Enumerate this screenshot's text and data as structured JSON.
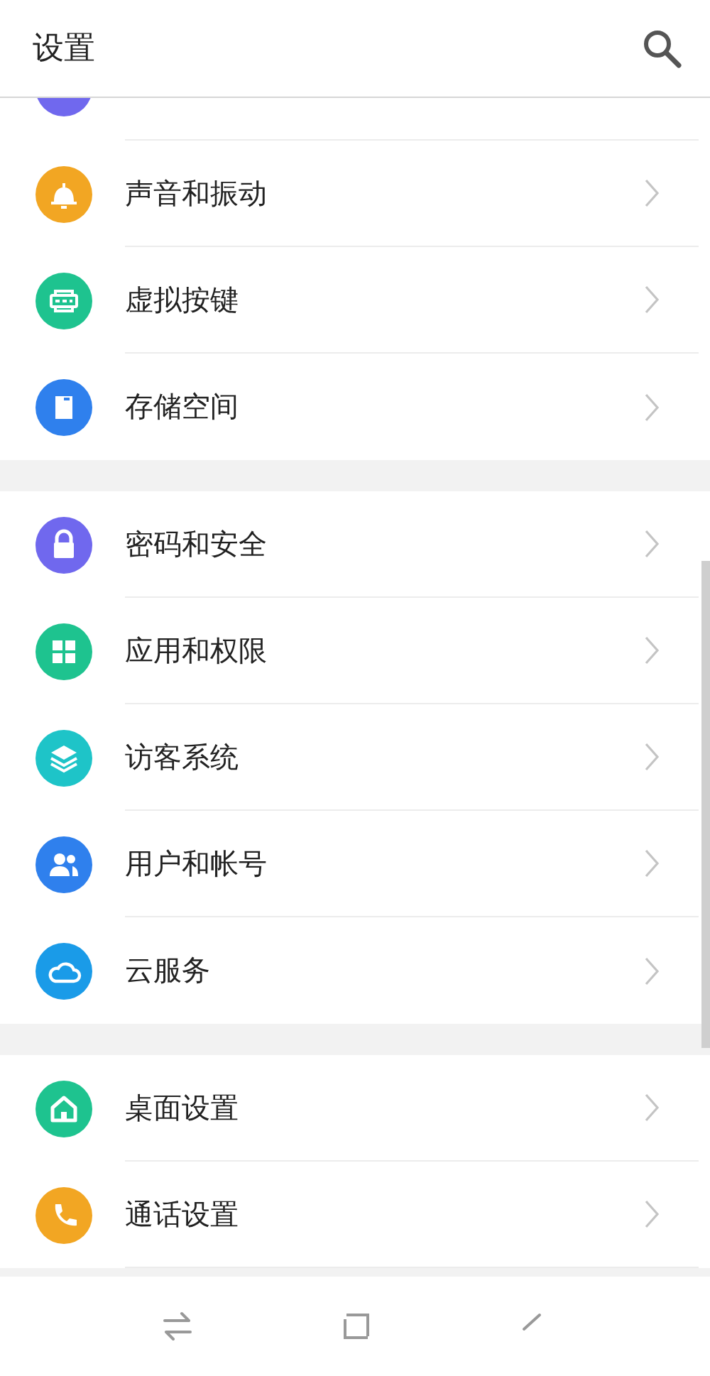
{
  "header": {
    "title": "设置"
  },
  "sections": [
    {
      "items": [
        {
          "kind": "partial",
          "color": "#7068ee"
        },
        {
          "kind": "row",
          "label": "声音和振动",
          "color": "#f2a623"
        },
        {
          "kind": "row",
          "label": "虚拟按键",
          "color": "#1ec38f"
        },
        {
          "kind": "row",
          "label": "存储空间",
          "color": "#2f80ed"
        }
      ]
    },
    {
      "items": [
        {
          "kind": "row",
          "label": "密码和安全",
          "color": "#7068ee"
        },
        {
          "kind": "row",
          "label": "应用和权限",
          "color": "#1ec38f"
        },
        {
          "kind": "row",
          "label": "访客系统",
          "color": "#1ec4c8"
        },
        {
          "kind": "row",
          "label": "用户和帐号",
          "color": "#2f80ed"
        },
        {
          "kind": "row",
          "label": "云服务",
          "color": "#1a9be8"
        }
      ]
    },
    {
      "items": [
        {
          "kind": "row",
          "label": "桌面设置",
          "color": "#1ec38f"
        },
        {
          "kind": "row",
          "label": "通话设置",
          "color": "#f2a623"
        }
      ]
    }
  ]
}
